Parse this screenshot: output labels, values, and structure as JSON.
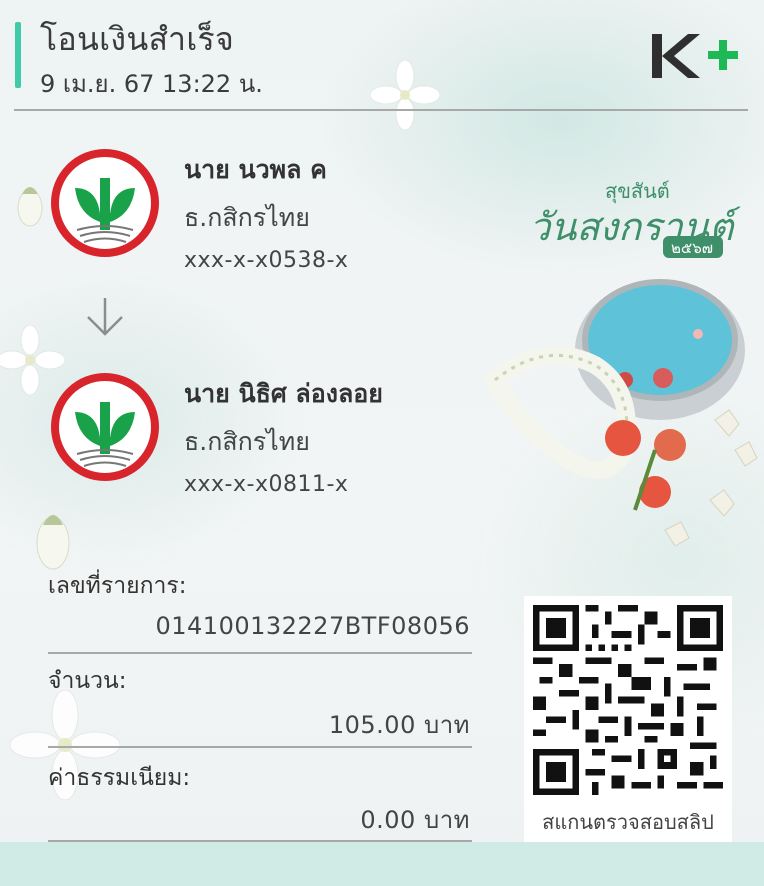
{
  "header": {
    "title": "โอนเงินสำเร็จ",
    "datetime": "9 เม.ย. 67  13:22 น.",
    "logo_text": "K+",
    "logo_icon": "k-plus-logo"
  },
  "sender": {
    "name": "นาย นวพล ค",
    "bank": "ธ.กสิกรไทย",
    "account": "xxx-x-x0538-x",
    "icon": "kasikorn-bank-logo"
  },
  "receiver": {
    "name": "นาย นิธิศ ล่องลอย",
    "bank": "ธ.กสิกรไทย",
    "account": "xxx-x-x0811-x",
    "icon": "kasikorn-bank-logo"
  },
  "transfer_icon": "arrow-down-icon",
  "details": {
    "ref_label": "เลขที่รายการ:",
    "ref_value": "014100132227BTF08056",
    "amount_label": "จำนวน:",
    "amount_value": "105.00 บาท",
    "fee_label": "ค่าธรรมเนียม:",
    "fee_value": "0.00 บาท"
  },
  "qr": {
    "caption": "สแกนตรวจสอบสลิป",
    "icon": "qr-code"
  },
  "decoration": {
    "title_small": "สุขสันต์",
    "title_large": "วันสงกรานต์",
    "year": "๒๕๖๗"
  },
  "colors": {
    "accent": "#3fcaa8",
    "kbank_green": "#1aa24b",
    "kbank_red": "#d8242b",
    "bottom_band": "#d0ebe6"
  }
}
